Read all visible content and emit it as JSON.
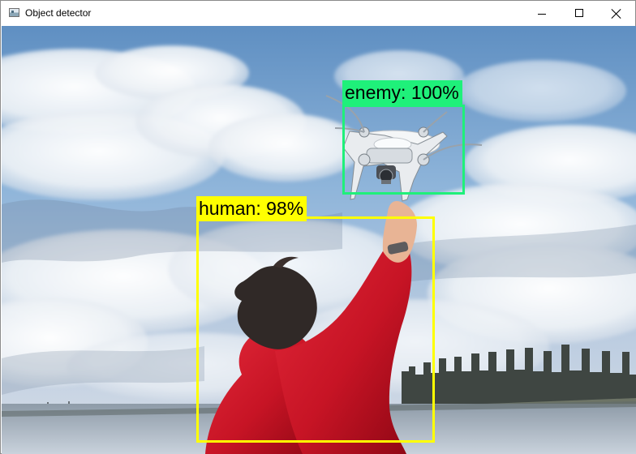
{
  "window": {
    "title": "Object detector",
    "app_icon": "image-window-icon",
    "controls": {
      "minimize": "minimize-icon",
      "maximize": "maximize-icon",
      "close": "close-icon"
    }
  },
  "detections": [
    {
      "label": "enemy: 100%",
      "color": "#1ff07a"
    },
    {
      "label": "human: 98%",
      "color": "#ffff00"
    }
  ]
}
